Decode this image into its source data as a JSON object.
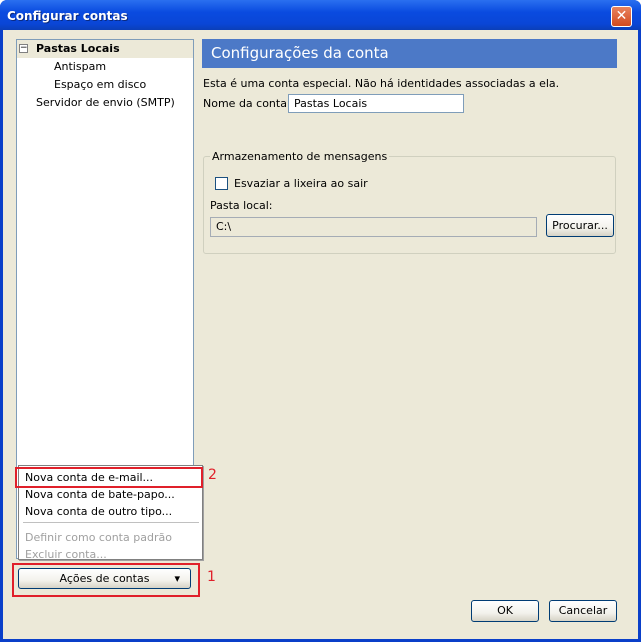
{
  "window": {
    "title": "Configurar contas",
    "close_glyph": "✕"
  },
  "tree": {
    "root": {
      "expander": "−",
      "label": "Pastas Locais"
    },
    "children": [
      {
        "label": "Antispam"
      },
      {
        "label": "Espaço em disco"
      }
    ],
    "smtp": {
      "label": "Servidor de envio (SMTP)"
    }
  },
  "account_actions_menu": {
    "items": [
      {
        "label": "Nova conta de e-mail...",
        "enabled": true
      },
      {
        "label": "Nova conta de bate-papo...",
        "enabled": true
      },
      {
        "label": "Nova conta de outro tipo...",
        "enabled": true
      }
    ],
    "disabled_items": [
      {
        "label": "Definir como conta padrão",
        "enabled": false
      },
      {
        "label": "Excluir conta...",
        "enabled": false
      }
    ],
    "button_label": "Ações de contas",
    "button_arrow": "▾"
  },
  "annotations": {
    "marker_1": "1",
    "marker_2": "2",
    "highlight_color": "#e0202a"
  },
  "settings": {
    "header": "Configurações da conta",
    "description": "Esta é uma conta especial. Não há identidades associadas a ela.",
    "account_name_label": "Nome da conta:",
    "account_name_value": "Pastas Locais",
    "storage_group_label": "Armazenamento de mensagens",
    "empty_trash_label": "Esvaziar a lixeira ao sair",
    "empty_trash_checked": false,
    "local_folder_label": "Pasta local:",
    "local_folder_value": "C:\\",
    "browse_button": "Procurar..."
  },
  "footer": {
    "ok_label": "OK",
    "cancel_label": "Cancelar"
  },
  "colors": {
    "header_bg": "#4c79c7",
    "dialog_bg": "#ece9d8",
    "titlebar": "#0a4be0"
  }
}
